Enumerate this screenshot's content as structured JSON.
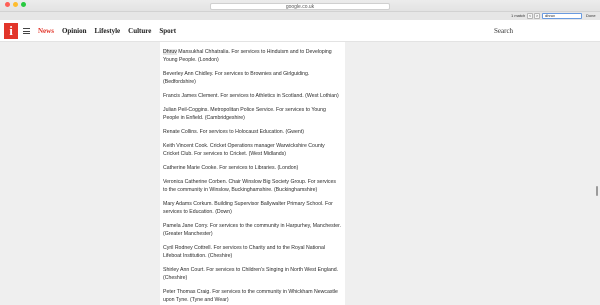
{
  "browser": {
    "url": "google.co.uk",
    "find": {
      "match_count": "1 match",
      "prev": "<",
      "next": ">",
      "query": "dhruv",
      "done_label": "Done"
    },
    "colors": {
      "close": "#ff5f57",
      "minimize": "#ffbd2e",
      "maximize": "#28c940"
    }
  },
  "header": {
    "logo": "i",
    "nav": [
      "News",
      "Opinion",
      "Lifestyle",
      "Culture",
      "Sport"
    ],
    "active_nav": "News",
    "search_label": "Search",
    "colors": {
      "brand": "#e2352a"
    }
  },
  "entries": [
    {
      "highlight": "Dhruv",
      "text": " Mansukhal Chhatralia. For services to Hinduism and to Developing Young People. (London)"
    },
    {
      "highlight": "",
      "text": "Beverley Ann Chidley. For services to Brownies and Girlguiding. (Bedfordshire)"
    },
    {
      "highlight": "",
      "text": "Francis James Clement. For services to Athletics in Scotland. (West Lothian)"
    },
    {
      "highlight": "",
      "text": "Julian Peil-Coggins. Metropolitan Police Service. For services to Young People in Enfield. (Cambridgeshire)"
    },
    {
      "highlight": "",
      "text": "Renate Collins. For services to Holocaust Education. (Gwent)"
    },
    {
      "highlight": "",
      "text": "Keith Vincent Cook. Cricket Operations manager Warwickshire County Cricket Club. For services to Cricket. (West Midlands)"
    },
    {
      "highlight": "",
      "text": "Catherine Marie Cooke. For services to Libraries. (London)"
    },
    {
      "highlight": "",
      "text": "Veronica Catherine Corben. Chair Winslow Big Society Group. For services to the community in Winslow, Buckinghamshire. (Buckinghamshire)"
    },
    {
      "highlight": "",
      "text": "Mary Adams Corkum. Building Supervisor Ballywalter Primary School. For services to Education. (Down)"
    },
    {
      "highlight": "",
      "text": "Pamela Jane Corry. For services to the community in Harpurhey, Manchester. (Greater Manchester)"
    },
    {
      "highlight": "",
      "text": "Cyril Rodney Cottrell. For services to Charity and to the Royal National Lifeboat Institution. (Cheshire)"
    },
    {
      "highlight": "",
      "text": "Shirley Ann Court. For services to Children's Singing in North West England. (Cheshire)"
    },
    {
      "highlight": "",
      "text": "Peter Thomas Craig. For services to the community in Whickham Newcastle upon Tyne. (Tyne and Wear)"
    }
  ]
}
